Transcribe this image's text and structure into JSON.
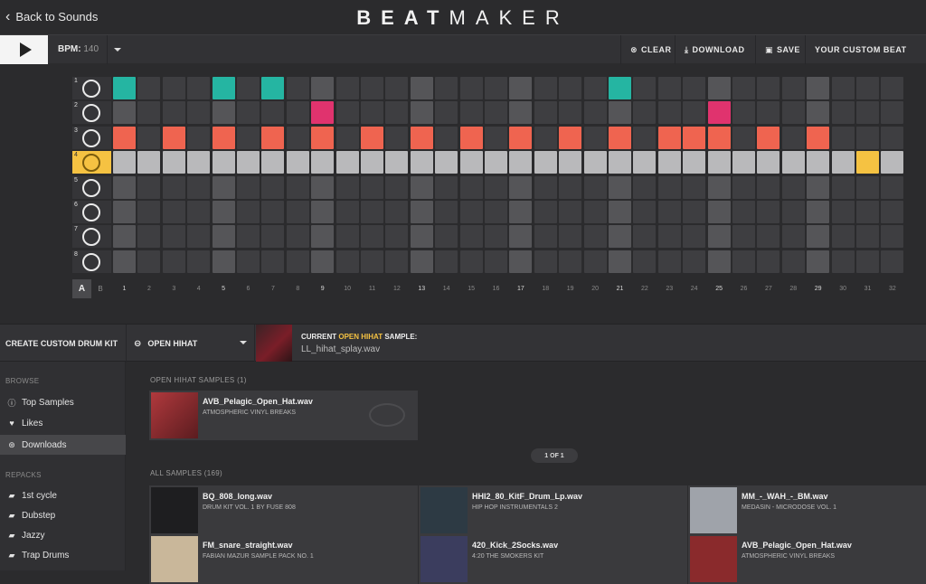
{
  "header": {
    "back_label": "Back to Sounds",
    "logo_bold": "BEAT",
    "logo_light": "MAKER"
  },
  "toolbar": {
    "bpm_label": "BPM:",
    "bpm_value": "140",
    "clear_label": "CLEAR",
    "download_label": "DOWNLOAD",
    "save_label": "SAVE",
    "custom_beat_label": "YOUR CUSTOM BEAT"
  },
  "sequencer": {
    "rows": [
      {
        "num": "1",
        "icon": "bass-drum-icon",
        "steps": [
          1,
          5,
          7,
          21
        ]
      },
      {
        "num": "2",
        "icon": "snare-icon",
        "steps": [
          9,
          25
        ]
      },
      {
        "num": "3",
        "icon": "closed-hihat-icon",
        "steps": [
          1,
          3,
          5,
          7,
          9,
          11,
          13,
          15,
          17,
          19,
          21,
          23,
          24,
          25,
          27,
          29
        ]
      },
      {
        "num": "4",
        "icon": "open-hihat-icon",
        "steps": [
          31
        ],
        "active": true
      },
      {
        "num": "5",
        "icon": "tom-icon",
        "steps": []
      },
      {
        "num": "6",
        "icon": "microphone-icon",
        "steps": []
      },
      {
        "num": "7",
        "icon": "shaker-icon",
        "steps": []
      },
      {
        "num": "8",
        "icon": "keys-icon",
        "steps": []
      }
    ],
    "colors": {
      "row1": "#25b5a2",
      "row2": "#e0336e",
      "row3": "#ef6450",
      "row4": "#f5c242",
      "empty": "#3e3e41",
      "beat_column": "#555558",
      "active_row_empty": "#b9b9bb"
    },
    "pattern_a": "A",
    "pattern_b": "B",
    "columns": [
      "1",
      "2",
      "3",
      "4",
      "5",
      "6",
      "7",
      "8",
      "9",
      "10",
      "11",
      "12",
      "13",
      "14",
      "15",
      "16",
      "17",
      "18",
      "19",
      "20",
      "21",
      "22",
      "23",
      "24",
      "25",
      "26",
      "27",
      "28",
      "29",
      "30",
      "31",
      "32"
    ]
  },
  "kit": {
    "title": "CREATE CUSTOM DRUM KIT",
    "selected_sound": "OPEN HIHAT",
    "current_prefix": "CURRENT",
    "current_highlight": "OPEN HIHAT",
    "current_suffix": "SAMPLE:",
    "current_file": "LL_hihat_splay.wav"
  },
  "sidebar": {
    "browse_head": "BROWSE",
    "browse_items": [
      {
        "label": "Top Samples",
        "icon": "info-icon"
      },
      {
        "label": "Likes",
        "icon": "heart-icon"
      },
      {
        "label": "Downloads",
        "icon": "download-icon",
        "selected": true
      }
    ],
    "repacks_head": "REPACKS",
    "repack_items": [
      {
        "label": "1st cycle"
      },
      {
        "label": "Dubstep"
      },
      {
        "label": "Jazzy"
      },
      {
        "label": "Trap Drums"
      }
    ]
  },
  "samples": {
    "open_head": "OPEN HIHAT SAMPLES (1)",
    "open_items": [
      {
        "file": "AVB_Pelagic_Open_Hat.wav",
        "pack": "ATMOSPHERIC VINYL BREAKS",
        "color": "#8a2a2c"
      }
    ],
    "pager": "1 OF 1",
    "all_head": "ALL SAMPLES (169)",
    "all_items": [
      {
        "file": "BQ_808_long.wav",
        "pack": "DRUM KIT VOL. 1 BY FUSE 808",
        "color": "#1e1e20"
      },
      {
        "file": "HHI2_80_KitF_Drum_Lp.wav",
        "pack": "HIP HOP INSTRUMENTALS 2",
        "color": "#2d3a44"
      },
      {
        "file": "MM_-_WAH_-_BM.wav",
        "pack": "MEDASIN - MICRODOSE VOL. 1",
        "color": "#9fa3aa"
      },
      {
        "file": "FM_snare_straight.wav",
        "pack": "FABIAN MAZUR SAMPLE PACK NO. 1",
        "color": "#c9b79a"
      },
      {
        "file": "420_Kick_2Socks.wav",
        "pack": "4:20 THE SMOKERS KIT",
        "color": "#3b3d5e"
      },
      {
        "file": "AVB_Pelagic_Open_Hat.wav",
        "pack": "ATMOSPHERIC VINYL BREAKS",
        "color": "#8a2a2c"
      }
    ]
  }
}
